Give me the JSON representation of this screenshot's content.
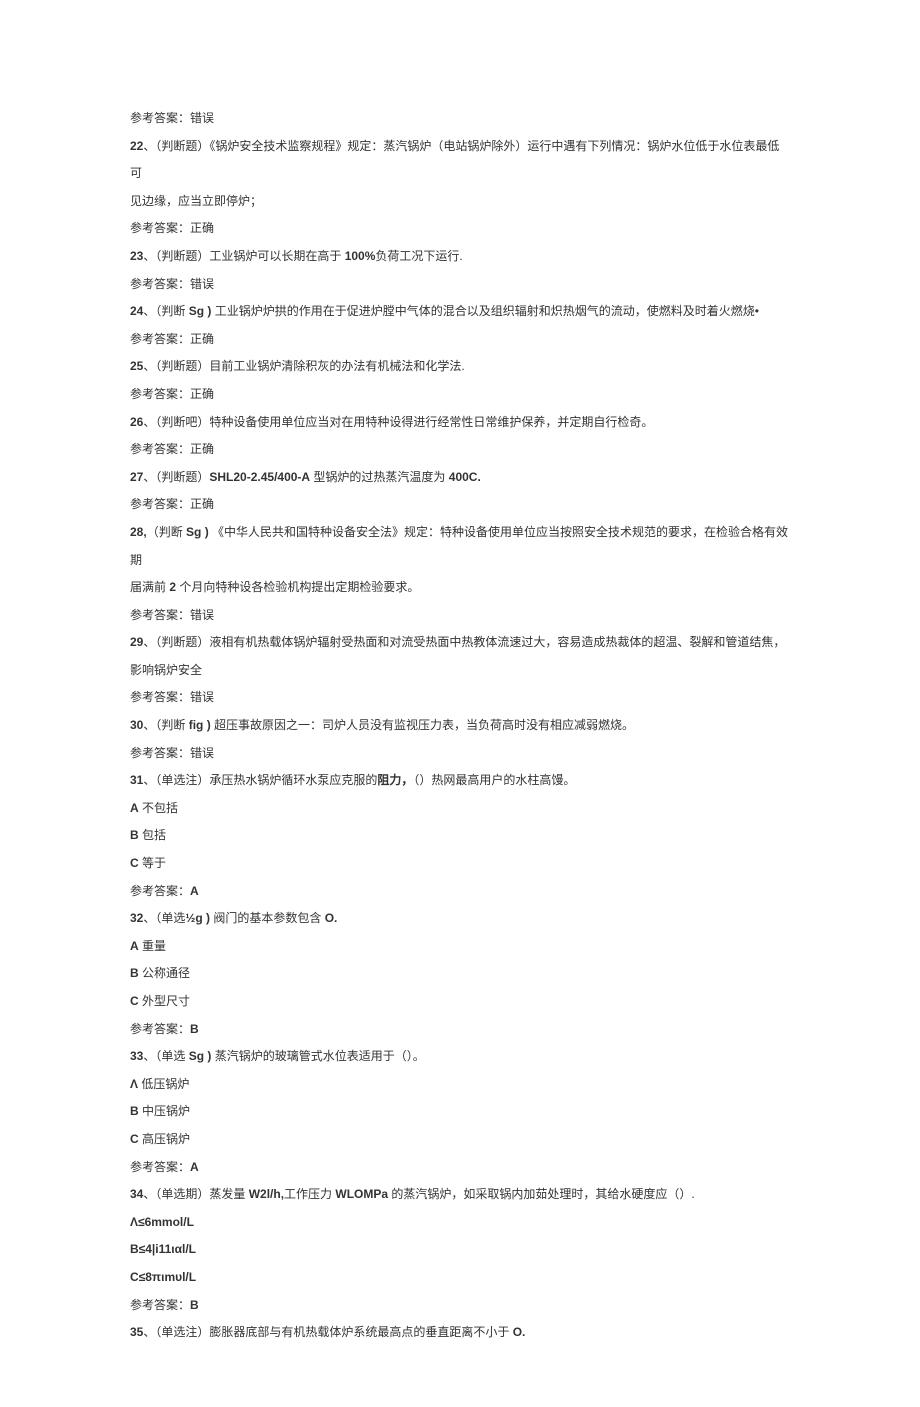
{
  "lines": [
    {
      "text": "参考答案：错误"
    },
    {
      "parts": [
        {
          "text": "22",
          "bold": true
        },
        {
          "text": "、（判断题）《锅炉安全技术监察规程》规定：蒸汽锅炉（电站锅炉除外）运行中遇有下列情况：锅炉水位低于水位表最低可"
        }
      ]
    },
    {
      "text": "见边缘，应当立即停炉；"
    },
    {
      "text": "参考答案：正确"
    },
    {
      "parts": [
        {
          "text": "23",
          "bold": true
        },
        {
          "text": "、（判断题）工业锅炉可以长期在高于 "
        },
        {
          "text": "100%",
          "bold": true
        },
        {
          "text": "负荷工况下运行."
        }
      ]
    },
    {
      "text": "参考答案：错误"
    },
    {
      "parts": [
        {
          "text": "24",
          "bold": true
        },
        {
          "text": "、（判断 "
        },
        {
          "text": "Sg )",
          "bold": true
        },
        {
          "text": " 工业锅炉炉拱的作用在于促进炉膛中气体的混合以及组织辐射和炽热烟气的流动，使燃料及时着火燃烧•"
        }
      ]
    },
    {
      "text": "参考答案：正确"
    },
    {
      "parts": [
        {
          "text": "25",
          "bold": true
        },
        {
          "text": "、（判断题）目前工业锅炉清除积灰的办法有机械法和化学法."
        }
      ]
    },
    {
      "text": "参考答案：正确"
    },
    {
      "parts": [
        {
          "text": "26",
          "bold": true
        },
        {
          "text": "、（判断吧）特种设备使用单位应当对在用特种设得进行经常性日常维护保养，并定期自行检奇。"
        }
      ]
    },
    {
      "text": "参考答案：正确"
    },
    {
      "parts": [
        {
          "text": "27",
          "bold": true
        },
        {
          "text": "、（判断题）"
        },
        {
          "text": "SHL20-2.45/400-A",
          "bold": true
        },
        {
          "text": " 型锅炉的过热蒸汽温度为 "
        },
        {
          "text": "400C.",
          "bold": true
        }
      ]
    },
    {
      "text": "参考答案：正确"
    },
    {
      "parts": [
        {
          "text": "28,",
          "bold": true
        },
        {
          "text": "（判断 "
        },
        {
          "text": "Sg )",
          "bold": true
        },
        {
          "text": " 《中华人民共和国特种设备安全法》规定：特种设备使用单位应当按照安全技术规范的要求，在检验合格有效期"
        }
      ]
    },
    {
      "parts": [
        {
          "text": "届满前 "
        },
        {
          "text": "2",
          "bold": true
        },
        {
          "text": " 个月向特种设各检验机构提出定期检验要求。"
        }
      ]
    },
    {
      "text": "参考答案：错误"
    },
    {
      "parts": [
        {
          "text": "29",
          "bold": true
        },
        {
          "text": "、（判断题）液相有机热载体锅炉辐射受热面和对流受热面中热教体流速过大，容易造成热裁体的超温、裂解和管道结焦，"
        }
      ]
    },
    {
      "text": "影响锅炉安全"
    },
    {
      "text": "参考答案：错误"
    },
    {
      "parts": [
        {
          "text": "30",
          "bold": true
        },
        {
          "text": "、（判断 "
        },
        {
          "text": "fig )",
          "bold": true
        },
        {
          "text": " 超压事故原因之一：司炉人员没有监视压力表，当负荷高时没有相应减弱燃烧。"
        }
      ]
    },
    {
      "text": "参考答案：错误"
    },
    {
      "parts": [
        {
          "text": "31",
          "bold": true
        },
        {
          "text": "、（单选注）承压热水锅炉循环水泵应克服的"
        },
        {
          "text": "阻力，",
          "bold": true
        },
        {
          "text": "（）热网最高用户的水柱高馒。"
        }
      ]
    },
    {
      "parts": [
        {
          "text": "A",
          "bold": true
        },
        {
          "text": " 不包括"
        }
      ]
    },
    {
      "parts": [
        {
          "text": "B",
          "bold": true
        },
        {
          "text": " 包括"
        }
      ]
    },
    {
      "parts": [
        {
          "text": "C",
          "bold": true
        },
        {
          "text": " 等于"
        }
      ]
    },
    {
      "parts": [
        {
          "text": "参考答案："
        },
        {
          "text": "A",
          "bold": true
        }
      ]
    },
    {
      "parts": [
        {
          "text": "32",
          "bold": true
        },
        {
          "text": "、（单选"
        },
        {
          "text": "½g )",
          "bold": true
        },
        {
          "text": " 阀门的基本参数包含 "
        },
        {
          "text": "O.",
          "bold": true
        }
      ]
    },
    {
      "parts": [
        {
          "text": "A",
          "bold": true
        },
        {
          "text": " 重量"
        }
      ]
    },
    {
      "parts": [
        {
          "text": "B",
          "bold": true
        },
        {
          "text": " 公称通径"
        }
      ]
    },
    {
      "parts": [
        {
          "text": "C",
          "bold": true
        },
        {
          "text": " 外型尺寸"
        }
      ]
    },
    {
      "parts": [
        {
          "text": "参考答案："
        },
        {
          "text": "B",
          "bold": true
        }
      ]
    },
    {
      "parts": [
        {
          "text": "33",
          "bold": true
        },
        {
          "text": "、（单选 "
        },
        {
          "text": "Sg )",
          "bold": true
        },
        {
          "text": " 蒸汽锅炉的玻璃管式水位表适用于（）。"
        }
      ]
    },
    {
      "parts": [
        {
          "text": "Λ",
          "bold": true
        },
        {
          "text": " 低压锅炉"
        }
      ]
    },
    {
      "parts": [
        {
          "text": "B",
          "bold": true
        },
        {
          "text": " 中压锅炉"
        }
      ]
    },
    {
      "parts": [
        {
          "text": "C",
          "bold": true
        },
        {
          "text": " 高压锅炉"
        }
      ]
    },
    {
      "parts": [
        {
          "text": "参考答案："
        },
        {
          "text": "A",
          "bold": true
        }
      ]
    },
    {
      "parts": [
        {
          "text": "34",
          "bold": true
        },
        {
          "text": "、（单选期）蒸发量 "
        },
        {
          "text": "W2l/h,",
          "bold": true
        },
        {
          "text": "工作压力 "
        },
        {
          "text": "WLOMPa",
          "bold": true
        },
        {
          "text": " 的蒸汽锅炉，如采取锅内加茹处理时，其给水硬度应（）."
        }
      ]
    },
    {
      "parts": [
        {
          "text": "Λ≤6mmol/L",
          "bold": true
        }
      ]
    },
    {
      "parts": [
        {
          "text": "B≤4|i11ιαl/L",
          "bold": true
        }
      ]
    },
    {
      "parts": [
        {
          "text": "C≤8πιmυl/L",
          "bold": true
        }
      ]
    },
    {
      "parts": [
        {
          "text": "参考答案："
        },
        {
          "text": "B",
          "bold": true
        }
      ]
    },
    {
      "parts": [
        {
          "text": "35",
          "bold": true
        },
        {
          "text": "、（单选注）膨胀器底部与有机热载体炉系统最高点的垂直距离不小于 "
        },
        {
          "text": "O.",
          "bold": true
        }
      ]
    }
  ]
}
